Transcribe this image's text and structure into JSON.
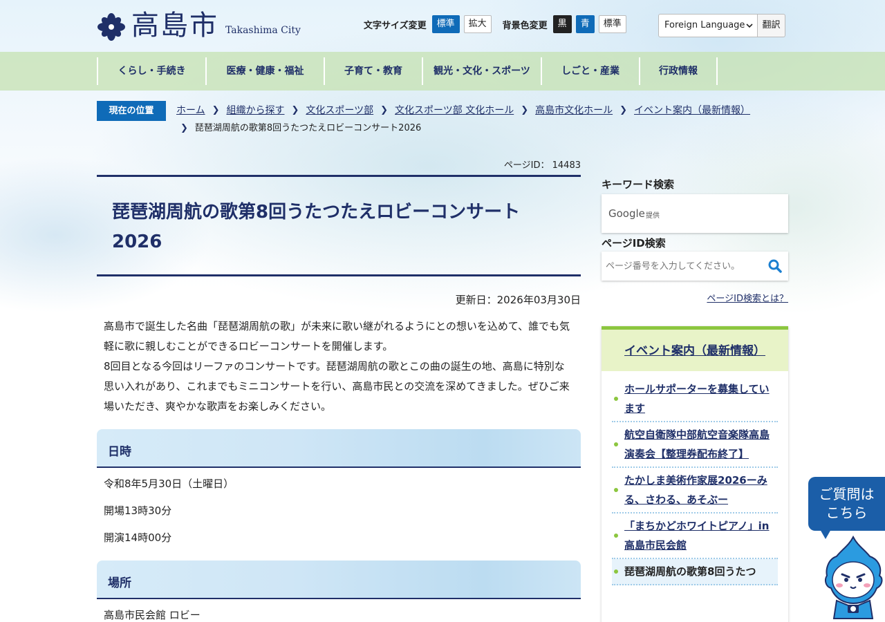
{
  "header": {
    "logo_text": "高島市",
    "logo_sub": "Takashima City",
    "font_label": "文字サイズ変更",
    "font_standard": "標準",
    "font_large": "拡大",
    "bg_label": "背景色変更",
    "bg_black": "黒",
    "bg_blue": "青",
    "bg_standard": "標準",
    "lang_select": "Foreign Language",
    "lang_button": "翻訳"
  },
  "nav": [
    {
      "label": "くらし・手続き"
    },
    {
      "label": "医療・健康・福祉"
    },
    {
      "label": "子育て・教育"
    },
    {
      "label": "観光・文化・スポーツ"
    },
    {
      "label": "しごと・産業"
    },
    {
      "label": "行政情報"
    }
  ],
  "breadcrumb": {
    "label": "現在の位置",
    "items": [
      "ホーム",
      "組織から探す",
      "文化スポーツ部",
      "文化スポーツ部 文化ホール",
      "高島市文化ホール",
      "イベント案内（最新情報）"
    ],
    "current": "琵琶湖周航の歌第8回うたつたえロビーコンサート2026"
  },
  "main": {
    "page_id_label": "ページID：",
    "page_id": "14483",
    "title": "琵琶湖周航の歌第8回うたつたえロビーコンサート2026",
    "updated": "更新日：2026年03月30日",
    "intro": [
      "高島市で誕生した名曲「琵琶湖周航の歌」が未来に歌い継がれるようにとの想いを込めて、誰でも気軽に歌に親しむことができるロビーコンサートを開催します。",
      "8回目となる今回はリーファのコンサートです。琵琶湖周航の歌とこの曲の誕生の地、高島に特別な思い入れがあり、これまでもミニコンサートを行い、高島市民との交流を深めてきました。ぜひご来場いただき、爽やかな歌声をお楽しみください。"
    ],
    "sections": [
      {
        "heading": "日時",
        "lines": [
          "令和8年5月30日（土曜日）",
          "開場13時30分",
          "開演14時00分"
        ]
      },
      {
        "heading": "場所",
        "lines": [
          "高島市民会館 ロビー"
        ]
      }
    ]
  },
  "sidebar": {
    "keyword_heading": "キーワード検索",
    "google_label": "Google",
    "google_provided": "提供",
    "pageid_heading": "ページID検索",
    "pageid_placeholder": "ページ番号を入力してください。",
    "pageid_what": "ページID検索とは？",
    "events_heading": "イベント案内（最新情報）",
    "events": [
      {
        "label": "ホールサポーターを募集しています"
      },
      {
        "label": "航空自衛隊中部航空音楽隊高島演奏会【整理券配布終了】"
      },
      {
        "label": "たかしま美術作家展2026ーみる、さわる、あそぶー"
      },
      {
        "label": "「まちかどホワイトピアノ」in高島市民会館"
      },
      {
        "label": "琵琶湖周航の歌第8回うたつ"
      }
    ]
  },
  "help": {
    "line1": "ご質問は",
    "line2": "こちら"
  },
  "colors": {
    "brand_navy": "#1f2f68",
    "accent_blue": "#0f6bb8",
    "accent_green": "#8cc63f"
  }
}
